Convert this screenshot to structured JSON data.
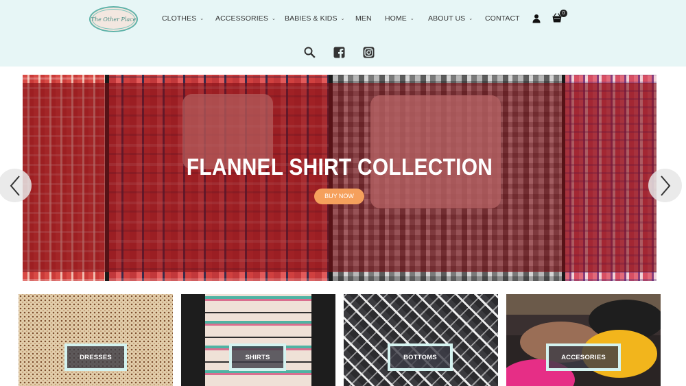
{
  "header": {
    "logo_text": "The Other Place",
    "nav": [
      {
        "label": "CLOTHES",
        "has_dropdown": true
      },
      {
        "label": "ACCESSORIES",
        "has_dropdown": true
      },
      {
        "label": "BABIES & KIDS",
        "has_dropdown": true
      },
      {
        "label": "MEN",
        "has_dropdown": false
      },
      {
        "label": "HOME",
        "has_dropdown": true
      },
      {
        "label": "ABOUT US",
        "has_dropdown": true
      },
      {
        "label": "CONTACT",
        "has_dropdown": false
      }
    ],
    "cart_count": "0",
    "icons": [
      "user-icon",
      "cart-icon",
      "search-icon",
      "facebook-icon",
      "instagram-icon"
    ]
  },
  "slider": {
    "title": "FLANNEL SHIRT COLLECTION",
    "button_label": "BUY NOW",
    "prev_icon": "chevron-left-icon",
    "next_icon": "chevron-right-icon"
  },
  "categories": [
    {
      "label": "DRESSES"
    },
    {
      "label": "SHIRTS"
    },
    {
      "label": "BOTTOMS"
    },
    {
      "label": "ACCESORIES"
    }
  ],
  "colors": {
    "header_bg": "#e7f6f6",
    "overlay": "#800e14",
    "button": "#f5a05c",
    "label_border": "#d4f3f0"
  }
}
